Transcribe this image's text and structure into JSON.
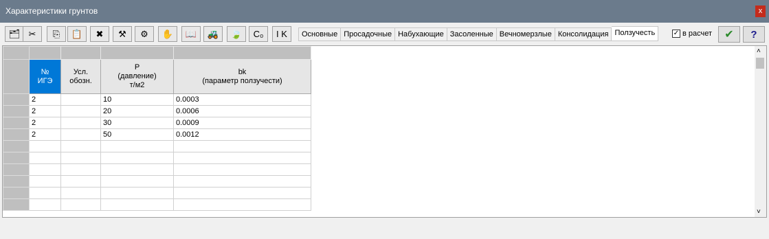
{
  "window": {
    "title": "Характеристики грунтов",
    "close_label": "x"
  },
  "toolbar": {
    "buttons": [
      {
        "icon": "open-icon",
        "glyph": "🗂"
      },
      {
        "icon": "cut-icon",
        "glyph": "✂"
      },
      {
        "icon": "copy-icon",
        "glyph": "⎘"
      },
      {
        "icon": "paste-icon",
        "glyph": "📋"
      },
      {
        "icon": "delete-icon",
        "glyph": "✖"
      },
      {
        "icon": "tool-icon",
        "glyph": "⚒"
      },
      {
        "icon": "disabled-icon",
        "glyph": "⚙"
      },
      {
        "icon": "hand-icon",
        "glyph": "✋"
      },
      {
        "icon": "book-icon",
        "glyph": "📖"
      },
      {
        "icon": "machine-icon",
        "glyph": "🚜"
      },
      {
        "icon": "leaf-icon",
        "glyph": "🍃"
      },
      {
        "icon": "c0-icon",
        "glyph": "C₀"
      },
      {
        "icon": "k-icon",
        "glyph": "I K"
      }
    ],
    "in_calc_label": "в расчет",
    "in_calc_checked": true,
    "ok_glyph": "✔",
    "help_glyph": "?"
  },
  "tabs": [
    {
      "label": "Основные"
    },
    {
      "label": "Просадочные"
    },
    {
      "label": "Набухающие"
    },
    {
      "label": "Засоленные"
    },
    {
      "label": "Вечномерзлые"
    },
    {
      "label": "Консолидация"
    },
    {
      "label": "Ползучесть",
      "active": true
    }
  ],
  "grid": {
    "headers": {
      "ige": [
        "№",
        "ИГЭ"
      ],
      "code": [
        "Усл.",
        "обозн."
      ],
      "p": [
        "P",
        "(давление)",
        "т/м2"
      ],
      "bk": [
        "bk",
        "(параметр ползучести)"
      ]
    },
    "rows": [
      {
        "ige": "2",
        "code": "",
        "p": "10",
        "bk": "0.0003"
      },
      {
        "ige": "2",
        "code": "",
        "p": "20",
        "bk": "0.0006"
      },
      {
        "ige": "2",
        "code": "",
        "p": "30",
        "bk": "0.0009"
      },
      {
        "ige": "2",
        "code": "",
        "p": "50",
        "bk": "0.0012"
      }
    ],
    "empty_rows": 6
  }
}
